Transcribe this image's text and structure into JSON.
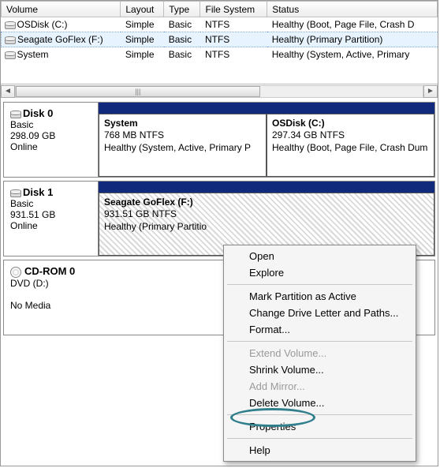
{
  "volumeTable": {
    "headers": [
      "Volume",
      "Layout",
      "Type",
      "File System",
      "Status"
    ],
    "rows": [
      {
        "name": "OSDisk (C:)",
        "layout": "Simple",
        "type": "Basic",
        "fs": "NTFS",
        "status": "Healthy (Boot, Page File, Crash D"
      },
      {
        "name": "Seagate GoFlex (F:)",
        "layout": "Simple",
        "type": "Basic",
        "fs": "NTFS",
        "status": "Healthy (Primary Partition)",
        "selected": true
      },
      {
        "name": "System",
        "layout": "Simple",
        "type": "Basic",
        "fs": "NTFS",
        "status": "Healthy (System, Active, Primary"
      }
    ]
  },
  "scroll": {
    "left": "◄",
    "right": "►",
    "grip": "|||"
  },
  "disks": [
    {
      "label": "Disk 0",
      "type": "Basic",
      "size": "298.09 GB",
      "state": "Online",
      "partitions": [
        {
          "title": "System",
          "line2": "768 MB NTFS",
          "line3": "Healthy (System, Active, Primary P",
          "widthPct": 50
        },
        {
          "title": "OSDisk  (C:)",
          "line2": "297.34 GB NTFS",
          "line3": "Healthy (Boot, Page File, Crash Dum",
          "widthPct": 50
        }
      ]
    },
    {
      "label": "Disk 1",
      "type": "Basic",
      "size": "931.51 GB",
      "state": "Online",
      "partitions": [
        {
          "title": "Seagate GoFlex  (F:)",
          "line2": "931.51 GB NTFS",
          "line3": "Healthy (Primary Partitio",
          "widthPct": 100,
          "hatched": true
        }
      ]
    },
    {
      "label": "CD-ROM 0",
      "type": "DVD (D:)",
      "size": "",
      "state": "No Media",
      "cd": true
    }
  ],
  "contextMenu": {
    "items": [
      {
        "label": "Open",
        "group": 1
      },
      {
        "label": "Explore",
        "group": 1
      },
      {
        "label": "Mark Partition as Active",
        "group": 2
      },
      {
        "label": "Change Drive Letter and Paths...",
        "group": 2
      },
      {
        "label": "Format...",
        "group": 2
      },
      {
        "label": "Extend Volume...",
        "group": 3,
        "disabled": true
      },
      {
        "label": "Shrink Volume...",
        "group": 3
      },
      {
        "label": "Add Mirror...",
        "group": 3,
        "disabled": true
      },
      {
        "label": "Delete Volume...",
        "group": 3
      },
      {
        "label": "Properties",
        "group": 4
      },
      {
        "label": "Help",
        "group": 5
      }
    ]
  }
}
